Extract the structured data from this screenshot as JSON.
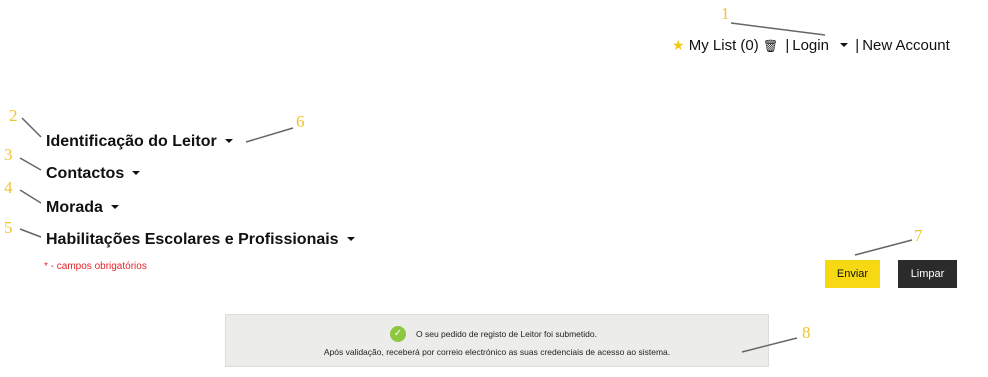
{
  "topnav": {
    "star_icon": "star-icon",
    "my_list": "My List",
    "count": "(0)",
    "trash_icon": "trash-icon",
    "separator": "|",
    "login": "Login",
    "new_account": "New Account"
  },
  "sections": [
    {
      "label": "Identificação do Leitor"
    },
    {
      "label": "Contactos"
    },
    {
      "label": "Morada"
    },
    {
      "label": "Habilitações Escolares e Profissionais"
    }
  ],
  "required_note": "* - campos obrigatórios",
  "buttons": {
    "send": "Enviar",
    "clear": "Limpar"
  },
  "notice": {
    "icon": "check-icon",
    "line1": "O seu pedido de registo de Leitor foi submetido.",
    "line2": "Após validação, receberá por correio electrónico as suas credenciais de acesso ao sistema."
  },
  "annotations": [
    "1",
    "2",
    "3",
    "4",
    "5",
    "6",
    "7",
    "8"
  ],
  "colors": {
    "accent_yellow": "#f7d913",
    "dark_button": "#2b2b2b",
    "required_red": "#e8232a",
    "annotation": "#f0c430",
    "success_green": "#8dc63f"
  }
}
